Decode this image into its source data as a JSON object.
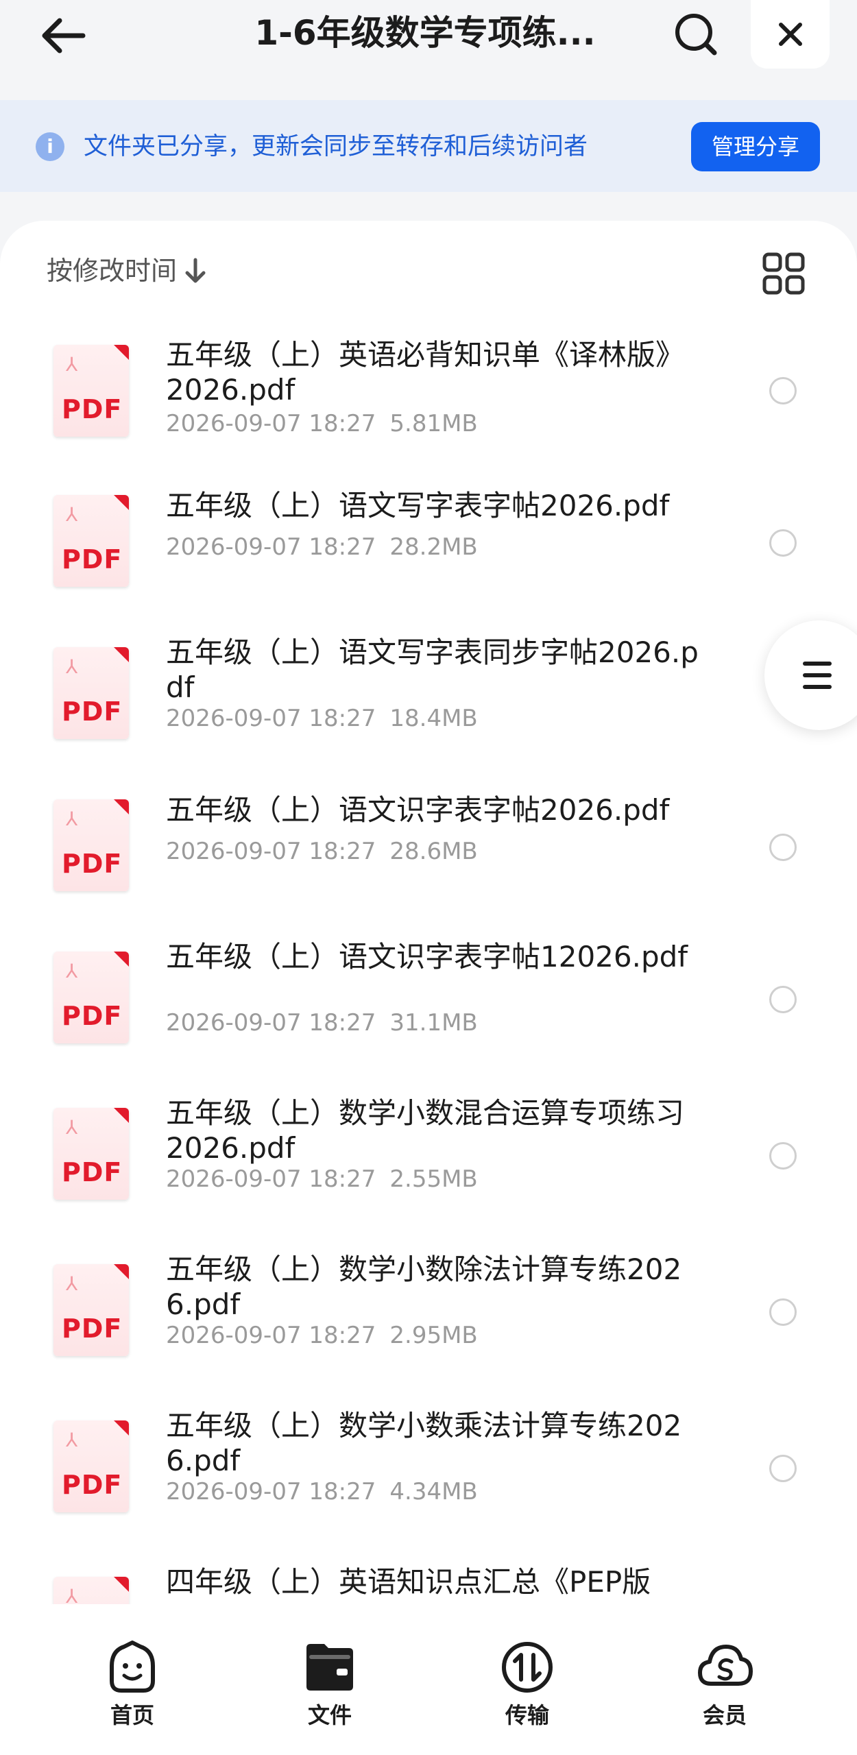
{
  "header": {
    "title": "1-6年级数学专项练..."
  },
  "banner": {
    "text": "文件夹已分享，更新会同步至转存和后续访问者",
    "manage_label": "管理分享"
  },
  "sort": {
    "label": "按修改时间",
    "direction": "desc"
  },
  "files": [
    {
      "name": "五年级（上）英语必背知识单《译林版》2026.pdf",
      "date": "2026-09-07 18:27",
      "size": "5.81MB"
    },
    {
      "name": "五年级（上）语文写字表字帖2026.pdf",
      "date": "2026-09-07 18:27",
      "size": "28.2MB"
    },
    {
      "name": "五年级（上）语文写字表同步字帖2026.pdf",
      "date": "2026-09-07 18:27",
      "size": "18.4MB"
    },
    {
      "name": "五年级（上）语文识字表字帖2026.pdf",
      "date": "2026-09-07 18:27",
      "size": "28.6MB"
    },
    {
      "name": "五年级（上）语文识字表字帖12026.pdf",
      "date": "2026-09-07 18:27",
      "size": "31.1MB"
    },
    {
      "name": "五年级（上）数学小数混合运算专项练习2026.pdf",
      "date": "2026-09-07 18:27",
      "size": "2.55MB"
    },
    {
      "name": "五年级（上）数学小数除法计算专练2026.pdf",
      "date": "2026-09-07 18:27",
      "size": "2.95MB"
    },
    {
      "name": "五年级（上）数学小数乘法计算专练2026.pdf",
      "date": "2026-09-07 18:27",
      "size": "4.34MB"
    },
    {
      "name": "四年级（上）英语知识点汇总《PEP版",
      "date": "",
      "size": ""
    }
  ],
  "pdf_label": "PDF",
  "nav": [
    {
      "label": "首页",
      "icon": "home-smile-icon"
    },
    {
      "label": "文件",
      "icon": "folder-icon",
      "active": true
    },
    {
      "label": "传输",
      "icon": "transfer-icon"
    },
    {
      "label": "会员",
      "icon": "vip-cloud-icon"
    }
  ],
  "colors": {
    "accent": "#1262f0",
    "banner_bg": "#e8eef9",
    "banner_text": "#1f5fd6",
    "pdf_red": "#e21b2c"
  }
}
